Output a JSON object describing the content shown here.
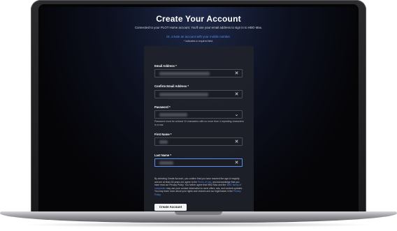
{
  "header": {
    "title": "Create Your Account",
    "subtitle": "Connected to your PLOT Home account. You'll use your email address to sign in to HBO Max.",
    "alt_link": "Or, create an account with your mobile number.",
    "required_note": "* indicates a required field."
  },
  "form": {
    "email": {
      "label": "Email Address *"
    },
    "confirm_email": {
      "label": "Confirm Email Address *"
    },
    "password": {
      "label": "Password *",
      "helper": "Password must be at least 10 characters with no more than 4 repeating characters in a row."
    },
    "first_name": {
      "label": "First Name *"
    },
    "last_name": {
      "label": "Last Name *"
    },
    "clear_glyph": "✕",
    "reveal_glyph": "⌄"
  },
  "legal": {
    "part1": "By selecting Create Account, you confirm that you have reached the age of majority and are at least 18 years old, agree to the ",
    "terms": "Terms of Use",
    "part2": ", and acknowledge that you have read our Privacy Policy. You further agree that HBO Max and the ",
    "family": "WBD family of companies",
    "part3": " may use your contact information to send offers, ads, and content updates. You may learn more about your rights and choices and our legal bases in the ",
    "privacy": "Privacy Policy",
    "part4": "."
  },
  "actions": {
    "create_label": "Create Account"
  },
  "colors": {
    "accent": "#5b8df0",
    "card": "#20222a",
    "background": "#050508"
  }
}
